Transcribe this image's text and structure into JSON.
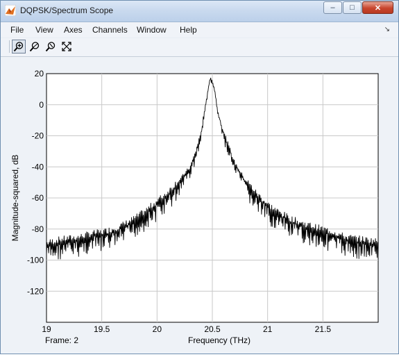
{
  "window": {
    "title": "DQPSK/Spectrum Scope",
    "minimize_glyph": "–",
    "maximize_glyph": "□",
    "close_glyph": "✕"
  },
  "menu": {
    "items": [
      {
        "label": "File"
      },
      {
        "label": "View"
      },
      {
        "label": "Axes"
      },
      {
        "label": "Channels"
      },
      {
        "label": "Window"
      },
      {
        "label": "Help"
      }
    ],
    "overflow_icon": "dock-arrow-icon"
  },
  "toolbar": {
    "tools": [
      {
        "name": "zoom-in-icon",
        "active": true
      },
      {
        "name": "zoom-x-icon",
        "active": false
      },
      {
        "name": "zoom-y-icon",
        "active": false
      },
      {
        "name": "autoscale-icon",
        "active": false
      }
    ]
  },
  "status": {
    "frame_text": "Frame: 2"
  },
  "chart_data": {
    "type": "line",
    "title": "",
    "xlabel": "Frequency (THz)",
    "ylabel": "Magnitude-squared, dB",
    "xlim": [
      19.0,
      22.0
    ],
    "ylim": [
      -140,
      20
    ],
    "xticks": [
      19,
      19.5,
      20,
      20.5,
      21,
      21.5
    ],
    "xtick_labels": [
      "19",
      "19.5",
      "20",
      "20.5",
      "21",
      "21.5"
    ],
    "yticks": [
      20,
      0,
      -20,
      -40,
      -60,
      -80,
      -100,
      -120
    ],
    "ytick_labels": [
      "20",
      "0",
      "-20",
      "-40",
      "-60",
      "-80",
      "-100",
      "-120"
    ],
    "grid": true,
    "line_color": "#000000",
    "series": [
      {
        "x": [
          19.0,
          19.1,
          19.2,
          19.3,
          19.4,
          19.5,
          19.6,
          19.7,
          19.8,
          19.9,
          20.0,
          20.1,
          20.2,
          20.3,
          20.35,
          20.4,
          20.45,
          20.48,
          20.5,
          20.52,
          20.55,
          20.6,
          20.65,
          20.7,
          20.8,
          20.9,
          21.0,
          21.1,
          21.2,
          21.3,
          21.4,
          21.5,
          21.6,
          21.7,
          21.8,
          21.9,
          22.0
        ],
        "y": [
          -91,
          -89,
          -88,
          -87,
          -85,
          -84,
          -82,
          -79,
          -75,
          -70,
          -64,
          -58,
          -50,
          -41,
          -31,
          -18,
          5,
          17,
          15,
          10,
          -5,
          -18,
          -28,
          -38,
          -50,
          -59,
          -66,
          -71,
          -75,
          -78,
          -80,
          -82,
          -84,
          -87,
          -88,
          -89,
          -90
        ]
      }
    ]
  }
}
